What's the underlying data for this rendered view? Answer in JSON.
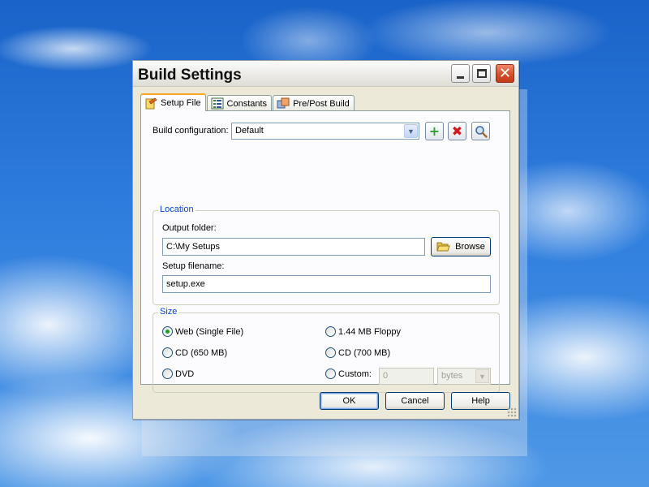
{
  "window": {
    "title": "Build Settings",
    "controls": {
      "minimize": "minimize-icon",
      "maximize": "maximize-icon",
      "close": "close-icon"
    }
  },
  "tabs": [
    {
      "label": "Setup File",
      "icon": "setup-file-icon",
      "active": true
    },
    {
      "label": "Constants",
      "icon": "constants-icon",
      "active": false
    },
    {
      "label": "Pre/Post Build",
      "icon": "pre-post-build-icon",
      "active": false
    }
  ],
  "build_configuration": {
    "label": "Build configuration:",
    "value": "Default",
    "buttons": {
      "add": "add-icon",
      "delete": "delete-icon",
      "search": "search-icon"
    }
  },
  "location": {
    "legend": "Location",
    "output_folder_label": "Output folder:",
    "output_folder_value": "C:\\My Setups",
    "browse_label": "Browse",
    "setup_filename_label": "Setup filename:",
    "setup_filename_value": "setup.exe"
  },
  "size": {
    "legend": "Size",
    "options": [
      {
        "label": "Web (Single File)",
        "selected": true
      },
      {
        "label": "1.44 MB Floppy",
        "selected": false
      },
      {
        "label": "CD (650 MB)",
        "selected": false
      },
      {
        "label": "CD (700 MB)",
        "selected": false
      },
      {
        "label": "DVD",
        "selected": false
      },
      {
        "label": "Custom:",
        "selected": false
      }
    ],
    "custom_value": "0",
    "custom_unit": "bytes"
  },
  "buttons": {
    "ok": "OK",
    "cancel": "Cancel",
    "help": "Help"
  },
  "colors": {
    "accent": "#0046d5",
    "tab_highlight": "#f5a623",
    "close": "#d6502c",
    "add": "#2fa12f",
    "delete": "#d21a1a"
  }
}
